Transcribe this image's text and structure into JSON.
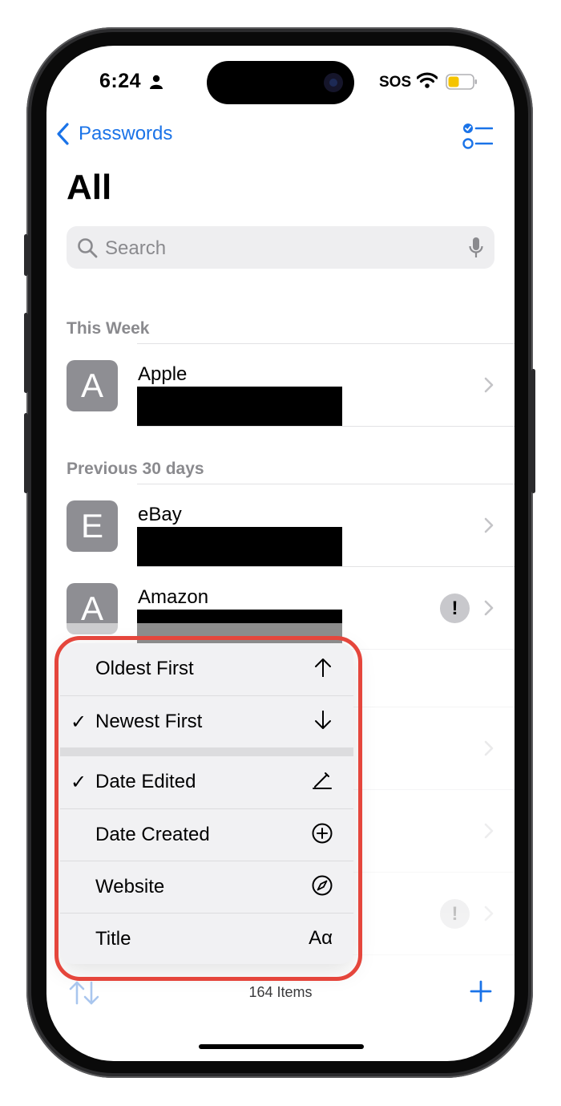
{
  "status_bar": {
    "time": "6:24",
    "carrier": "SOS"
  },
  "nav": {
    "back_label": "Passwords"
  },
  "page": {
    "title": "All"
  },
  "search": {
    "placeholder": "Search"
  },
  "sections": [
    {
      "header": "This Week"
    },
    {
      "header": "Previous 30 days"
    }
  ],
  "rows": [
    {
      "letter": "A",
      "title": "Apple"
    },
    {
      "letter": "E",
      "title": "eBay"
    },
    {
      "letter": "A",
      "title": "Amazon",
      "warning": "!"
    },
    {
      "warning": "!"
    }
  ],
  "sort_menu": {
    "order": [
      {
        "label": "Oldest First",
        "icon": "↑",
        "checked": false
      },
      {
        "label": "Newest First",
        "icon": "↓",
        "checked": true
      }
    ],
    "fields": [
      {
        "label": "Date Edited",
        "icon": "pencil-icon",
        "checked": true
      },
      {
        "label": "Date Created",
        "icon": "plus-circle-icon",
        "checked": false
      },
      {
        "label": "Website",
        "icon": "compass-icon",
        "checked": false
      },
      {
        "label": "Title",
        "icon": "Aα",
        "checked": false
      }
    ],
    "check_mark": "✓"
  },
  "toolbar": {
    "count": "164 Items"
  },
  "colors": {
    "accent": "#1a73e8",
    "highlight": "#e5463c",
    "avatar": "#8e8e93"
  }
}
